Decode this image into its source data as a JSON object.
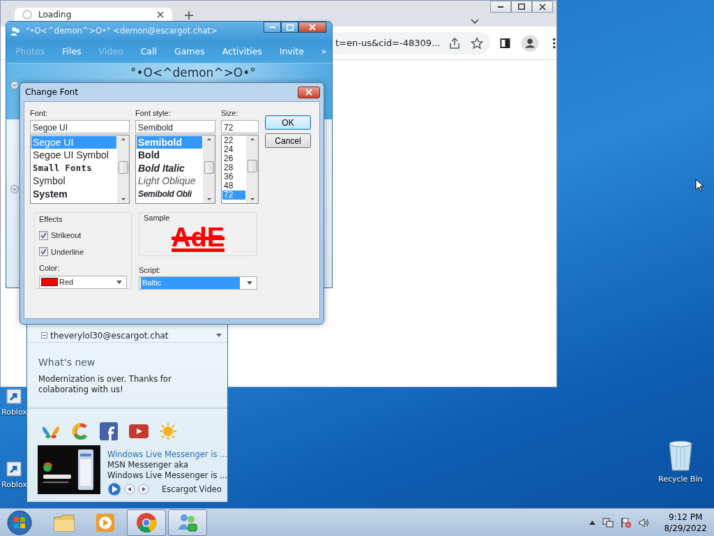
{
  "browser": {
    "tab": {
      "title": "Loading"
    },
    "address": "t=en-us&cid=-48309..."
  },
  "conversation": {
    "title": "°•O<^demon^>O•° <demon@escargot.chat>",
    "toolbar": [
      {
        "label": "Photos",
        "disabled": true
      },
      {
        "label": "Files",
        "disabled": false
      },
      {
        "label": "Video",
        "disabled": true
      },
      {
        "label": "Call",
        "disabled": false
      },
      {
        "label": "Games",
        "disabled": false
      },
      {
        "label": "Activities",
        "disabled": false
      },
      {
        "label": "Invite",
        "disabled": false
      },
      {
        "label": "»",
        "disabled": false
      }
    ],
    "contact_name": "°•O<^demon^>O•°"
  },
  "messenger": {
    "contacts": [
      {
        "label": "theverylol30@escargot.chat"
      }
    ],
    "whats_new": {
      "heading": "What's new",
      "text": "Modernization is over. Thanks for colaborating with us!"
    },
    "video": {
      "title": "Windows Live Messenger is ...",
      "lines": [
        "MSN Messenger aka",
        "Windows Live Messenger is ..."
      ],
      "source": "Escargot Video"
    }
  },
  "font_dialog": {
    "title": "Change Font",
    "font": {
      "label": "Font:",
      "value": "Segoe UI",
      "items": [
        {
          "label": "Segoe UI",
          "kind": "regular",
          "selected": true
        },
        {
          "label": "Segoe UI Symbol",
          "kind": "regular",
          "selected": false
        },
        {
          "label": "Small Fonts",
          "kind": "pixel",
          "selected": false
        },
        {
          "label": "Symbol",
          "kind": "regular",
          "selected": false
        },
        {
          "label": "System",
          "kind": "bold",
          "selected": false
        }
      ]
    },
    "style": {
      "label": "Font style:",
      "value": "Semibold",
      "items": [
        {
          "label": "Semibold",
          "kind": "semibold",
          "selected": true
        },
        {
          "label": "Bold",
          "kind": "bold",
          "selected": false
        },
        {
          "label": "Bold Italic",
          "kind": "bold-italic",
          "selected": false
        },
        {
          "label": "Light Oblique",
          "kind": "light-italic",
          "selected": false
        },
        {
          "label": "Semibold Obli",
          "kind": "semibold-italic",
          "selected": false
        }
      ]
    },
    "size": {
      "label": "Size:",
      "value": "72",
      "items": [
        {
          "label": "22",
          "selected": false
        },
        {
          "label": "24",
          "selected": false
        },
        {
          "label": "26",
          "selected": false
        },
        {
          "label": "28",
          "selected": false
        },
        {
          "label": "36",
          "selected": false
        },
        {
          "label": "48",
          "selected": false
        },
        {
          "label": "72",
          "selected": true
        }
      ]
    },
    "buttons": [
      {
        "label": "OK",
        "default": true
      },
      {
        "label": "Cancel",
        "default": false
      }
    ],
    "effects": {
      "label": "Effects",
      "options": [
        {
          "label": "Strikeout",
          "checked": true
        },
        {
          "label": "Underline",
          "checked": true
        }
      ]
    },
    "color": {
      "label": "Color:",
      "value": "Red",
      "color": "#ff0000"
    },
    "sample": {
      "label": "Sample",
      "text": "AdE"
    },
    "script": {
      "label": "Script:",
      "value": "Baltic"
    }
  },
  "desktop_icons": [
    {
      "label": "Roblox",
      "kind": "shortcut"
    },
    {
      "label": "Roblox",
      "kind": "shortcut"
    },
    {
      "label": "Recycle Bin",
      "kind": "bin"
    }
  ],
  "taskbar": {
    "apps": [
      {
        "kind": "folder",
        "active": false
      },
      {
        "kind": "media",
        "active": false
      },
      {
        "kind": "browser",
        "active": true
      },
      {
        "kind": "messenger",
        "active": true
      }
    ],
    "time": "9:12 PM",
    "date": "8/29/2022"
  }
}
